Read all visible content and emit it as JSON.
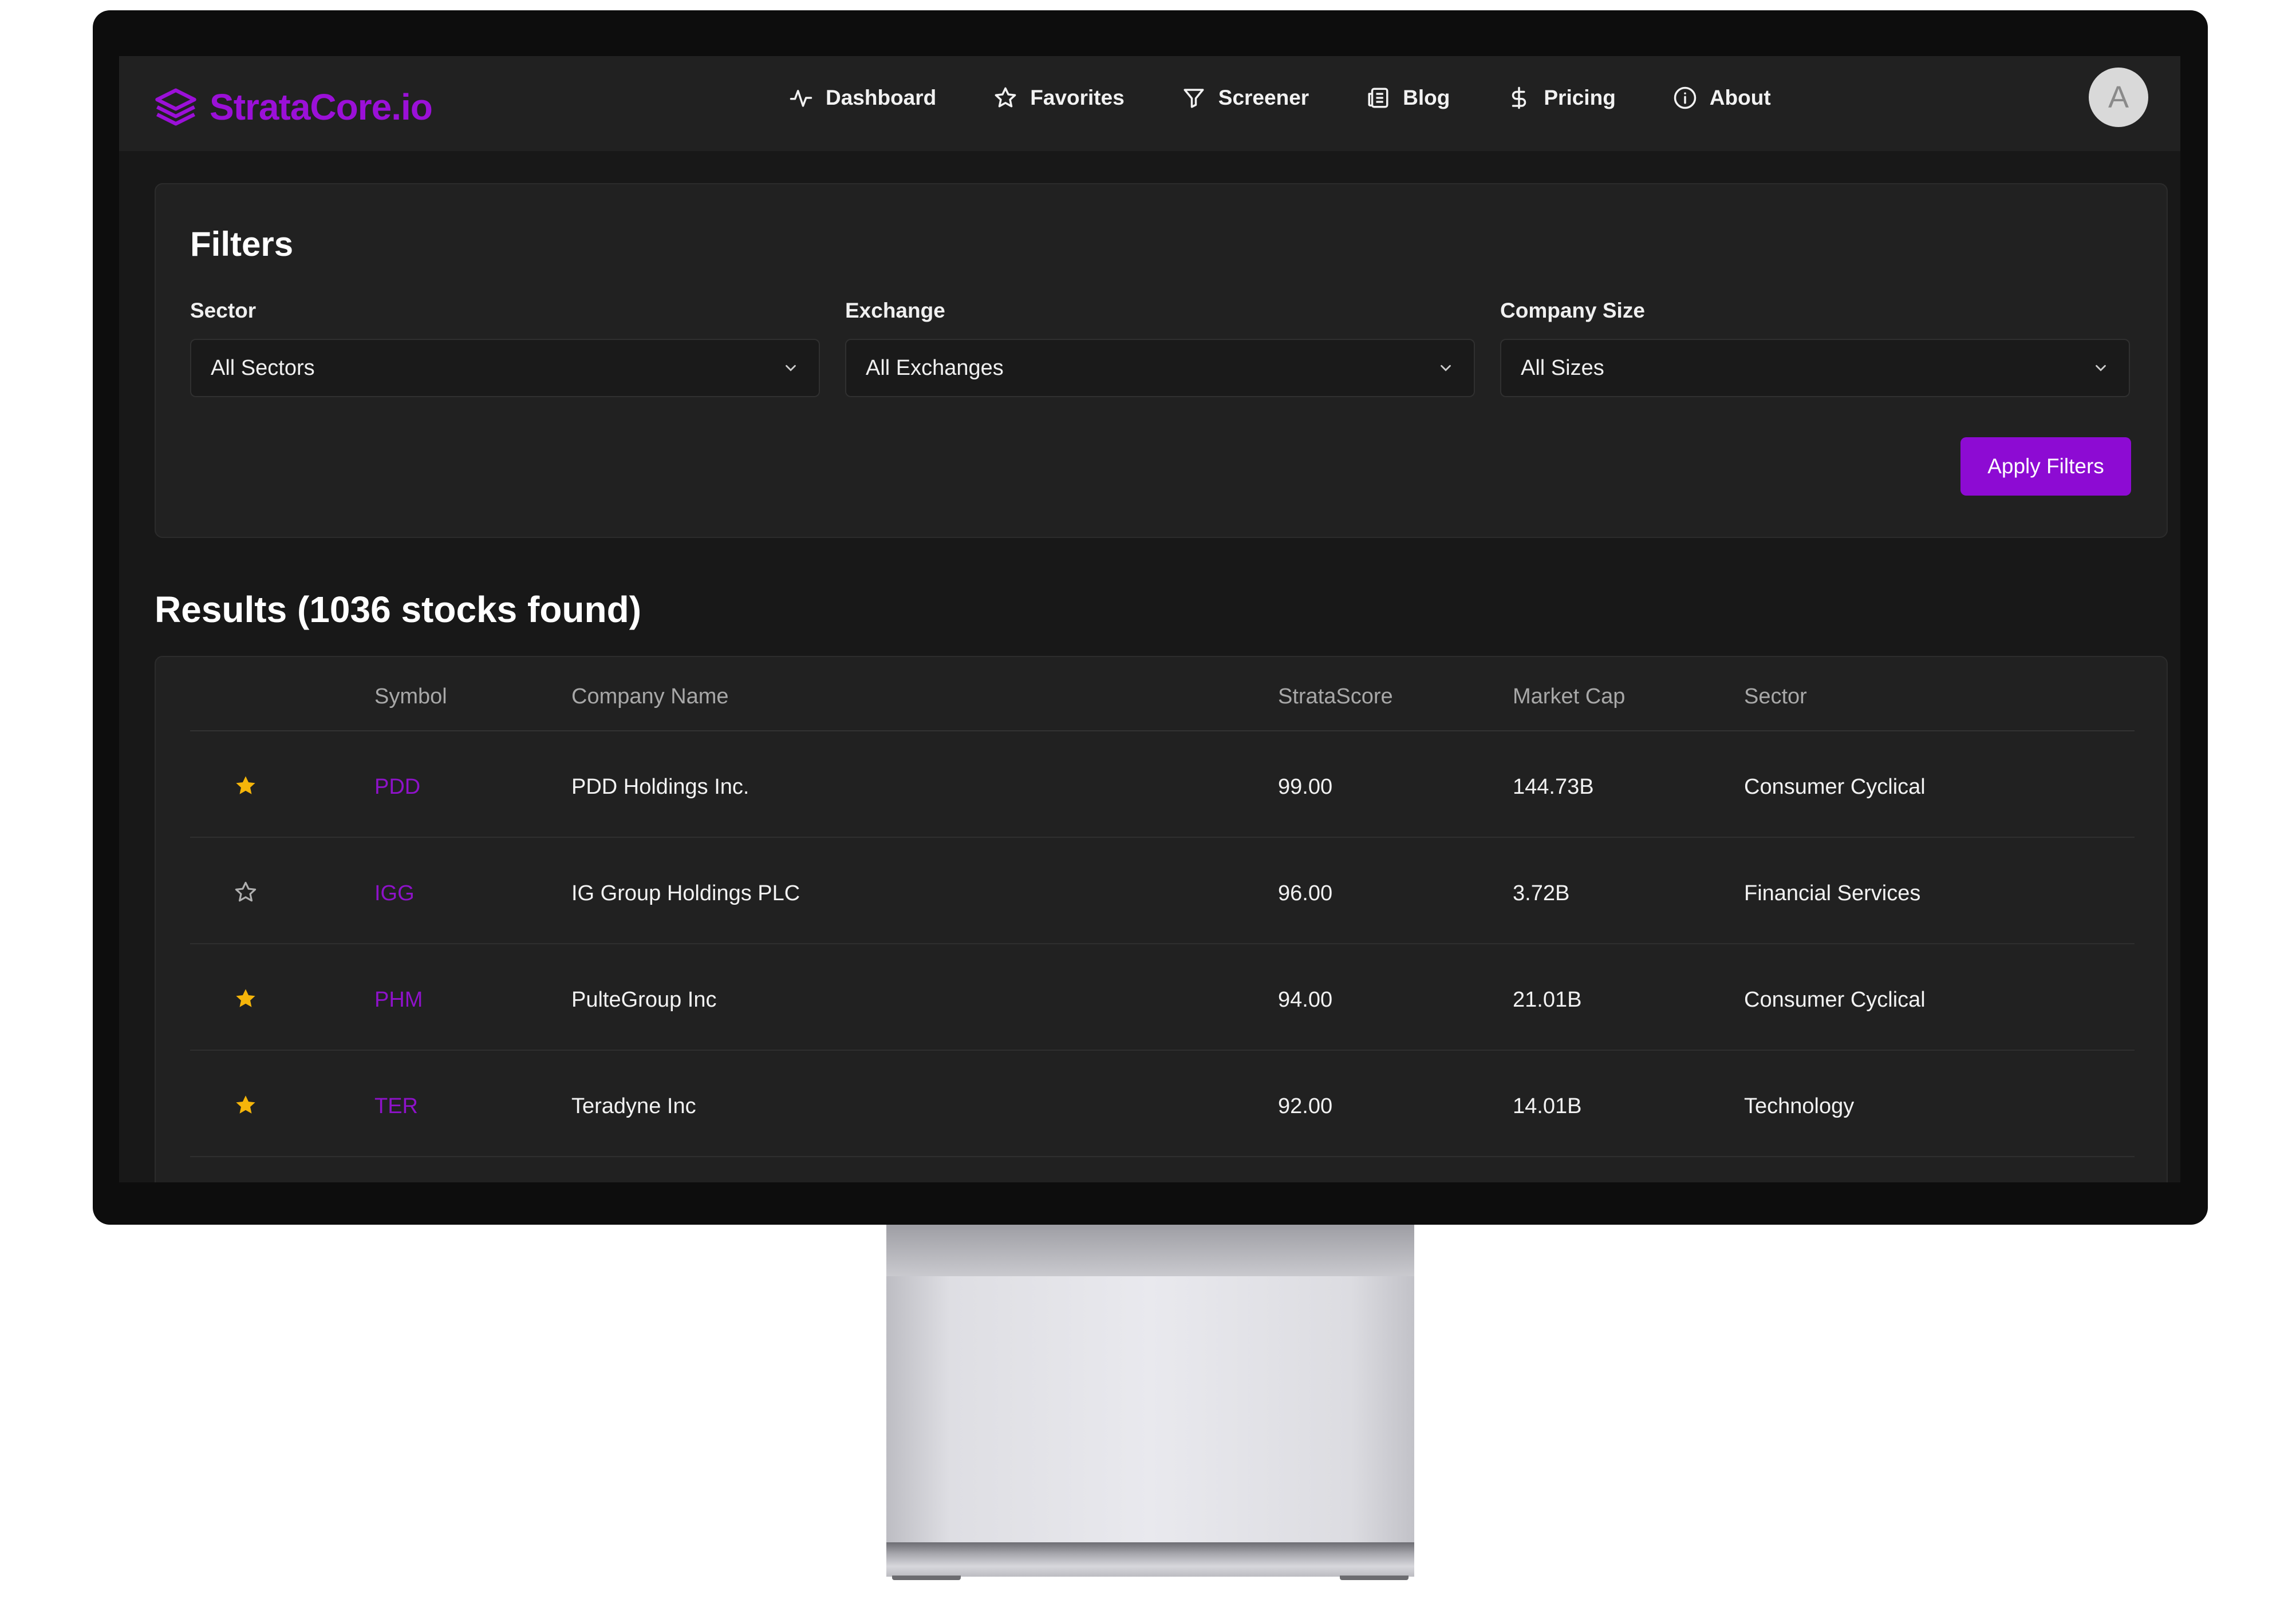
{
  "brand": {
    "name": "StrataCore.io",
    "color": "#9b10d8"
  },
  "nav": [
    {
      "label": "Dashboard",
      "icon": "activity-icon"
    },
    {
      "label": "Favorites",
      "icon": "star-icon"
    },
    {
      "label": "Screener",
      "icon": "filter-icon"
    },
    {
      "label": "Blog",
      "icon": "newspaper-icon"
    },
    {
      "label": "Pricing",
      "icon": "dollar-icon"
    },
    {
      "label": "About",
      "icon": "info-icon"
    }
  ],
  "user": {
    "avatar_letter": "A"
  },
  "filters": {
    "title": "Filters",
    "sector": {
      "label": "Sector",
      "value": "All Sectors"
    },
    "exchange": {
      "label": "Exchange",
      "value": "All Exchanges"
    },
    "company_size": {
      "label": "Company Size",
      "value": "All Sizes"
    },
    "apply_label": "Apply Filters"
  },
  "results": {
    "title": "Results (1036 stocks found)",
    "columns": [
      "Symbol",
      "Company Name",
      "StrataScore",
      "Market Cap",
      "Sector"
    ],
    "rows": [
      {
        "favorite": true,
        "symbol": "PDD",
        "company": "PDD Holdings Inc.",
        "score": "99.00",
        "market_cap": "144.73B",
        "sector": "Consumer Cyclical"
      },
      {
        "favorite": false,
        "symbol": "IGG",
        "company": "IG Group Holdings PLC",
        "score": "96.00",
        "market_cap": "3.72B",
        "sector": "Financial Services"
      },
      {
        "favorite": true,
        "symbol": "PHM",
        "company": "PulteGroup Inc",
        "score": "94.00",
        "market_cap": "21.01B",
        "sector": "Consumer Cyclical"
      },
      {
        "favorite": true,
        "symbol": "TER",
        "company": "Teradyne Inc",
        "score": "92.00",
        "market_cap": "14.01B",
        "sector": "Technology"
      }
    ]
  },
  "colors": {
    "accent": "#8d0bd3",
    "star_filled": "#f5b50a",
    "star_empty": "#b0b0b0"
  }
}
